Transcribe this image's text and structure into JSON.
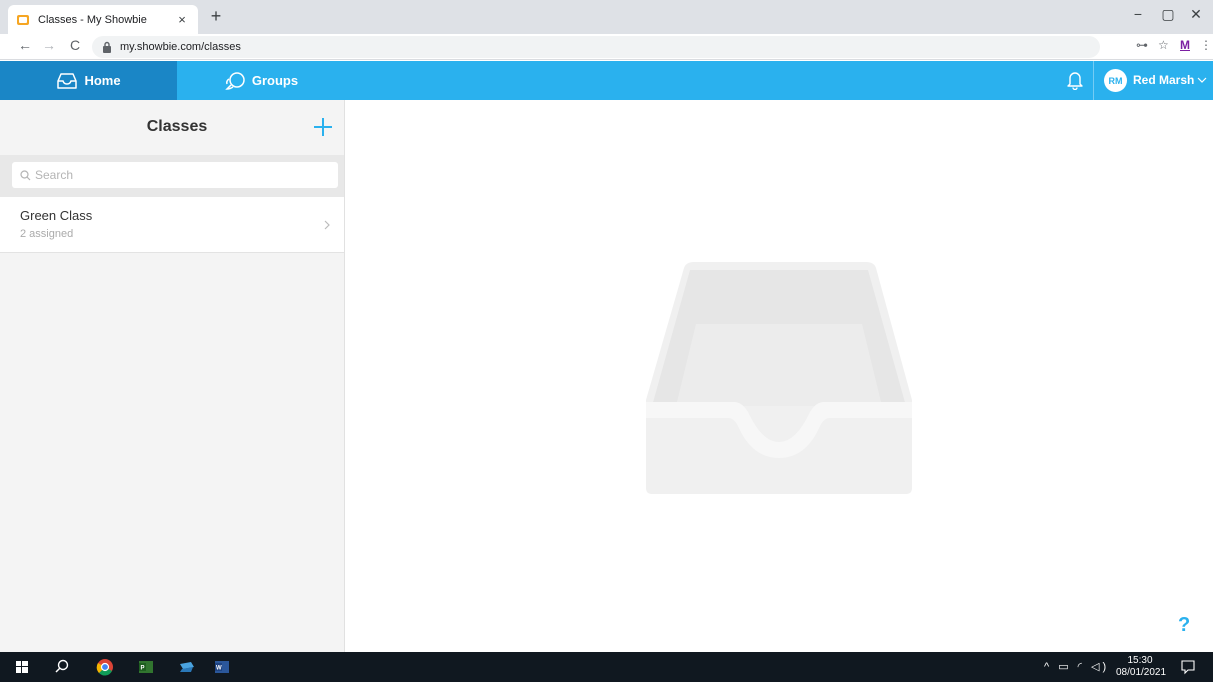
{
  "browser": {
    "tab_title": "Classes - My Showbie",
    "tab_close": "×",
    "new_tab": "+",
    "url": "my.showbie.com/classes",
    "window_controls": {
      "minimize": "−",
      "maximize": "▢",
      "close": "✕"
    },
    "nav": {
      "back": "←",
      "forward": "→",
      "reload": "C"
    },
    "toolbar_right": {
      "key": "⊶",
      "star": "☆",
      "profile": "M",
      "menu": "⋮"
    }
  },
  "header": {
    "nav": [
      {
        "label": "Home",
        "icon": "inbox-icon",
        "active": true
      },
      {
        "label": "Groups",
        "icon": "chat-bubbles-icon",
        "active": false
      }
    ],
    "user": {
      "initials": "RM",
      "name": "Red Marsh"
    },
    "colors": {
      "bar": "#2ab1ee",
      "active_tab": "#1a86c6"
    }
  },
  "sidebar": {
    "title": "Classes",
    "search_placeholder": "Search",
    "classes": [
      {
        "name": "Green Class",
        "subtitle": "2 assigned"
      }
    ]
  },
  "help_label": "?",
  "taskbar": {
    "time": "15:30",
    "date": "08/01/2021",
    "tray_symbols": "^ ▭ ◜ ◁)"
  }
}
